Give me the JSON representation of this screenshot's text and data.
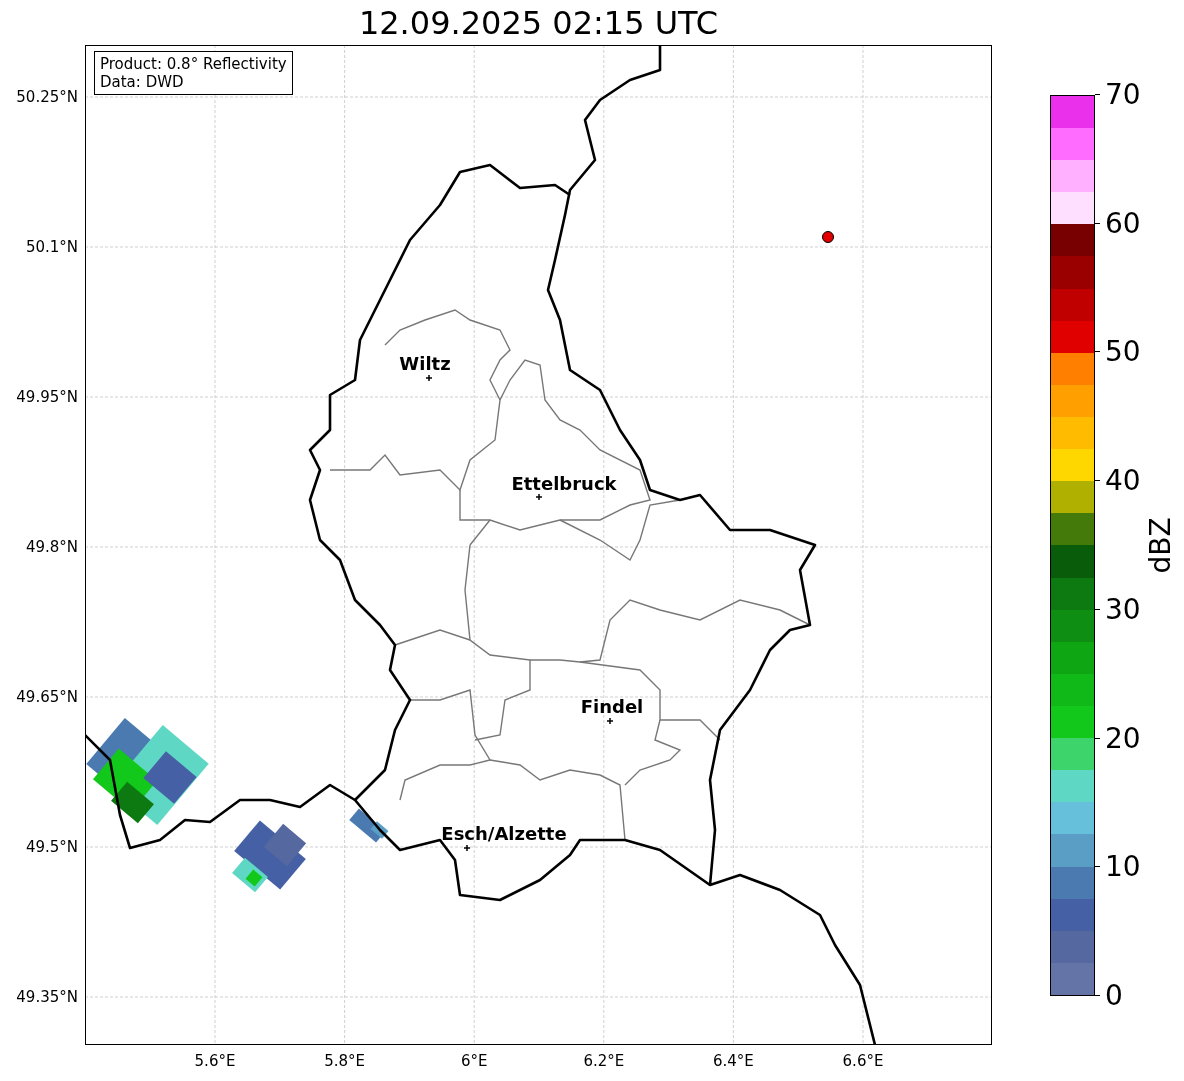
{
  "title": "12.09.2025 02:15 UTC",
  "info_box": [
    "Product: 0.8° Reflectivity",
    "Data: DWD"
  ],
  "map": {
    "lat_ticks": [
      "50.25°N",
      "50.1°N",
      "49.95°N",
      "49.8°N",
      "49.65°N",
      "49.5°N",
      "49.35°N"
    ],
    "lon_ticks": [
      "5.6°E",
      "5.8°E",
      "6°E",
      "6.2°E",
      "6.4°E",
      "6.6°E"
    ],
    "cities": [
      {
        "name": "Wiltz"
      },
      {
        "name": "Ettelbruck"
      },
      {
        "name": "Findel"
      },
      {
        "name": "Esch/Alzette"
      }
    ]
  },
  "colorbar": {
    "label": "dBZ",
    "ticks": [
      "70",
      "60",
      "50",
      "40",
      "30",
      "20",
      "10",
      "0"
    ],
    "segments": [
      {
        "color": "#6474a6"
      },
      {
        "color": "#5569a0"
      },
      {
        "color": "#4560a4"
      },
      {
        "color": "#4a7ab0"
      },
      {
        "color": "#5a9ec6"
      },
      {
        "color": "#66c0dc"
      },
      {
        "color": "#5ed8c4"
      },
      {
        "color": "#3dd46c"
      },
      {
        "color": "#12c81a"
      },
      {
        "color": "#10b818"
      },
      {
        "color": "#0fa614"
      },
      {
        "color": "#0e8e12"
      },
      {
        "color": "#0c7a10"
      },
      {
        "color": "#085c0a"
      },
      {
        "color": "#447a0a"
      },
      {
        "color": "#b0b000"
      },
      {
        "color": "#ffd700"
      },
      {
        "color": "#ffbb00"
      },
      {
        "color": "#ff9f00"
      },
      {
        "color": "#ff7f00"
      },
      {
        "color": "#e00000"
      },
      {
        "color": "#c00000"
      },
      {
        "color": "#9a0000"
      },
      {
        "color": "#780000"
      },
      {
        "color": "#ffdfff"
      },
      {
        "color": "#ffb0ff"
      },
      {
        "color": "#ff6cff"
      },
      {
        "color": "#ea30ea"
      }
    ]
  }
}
